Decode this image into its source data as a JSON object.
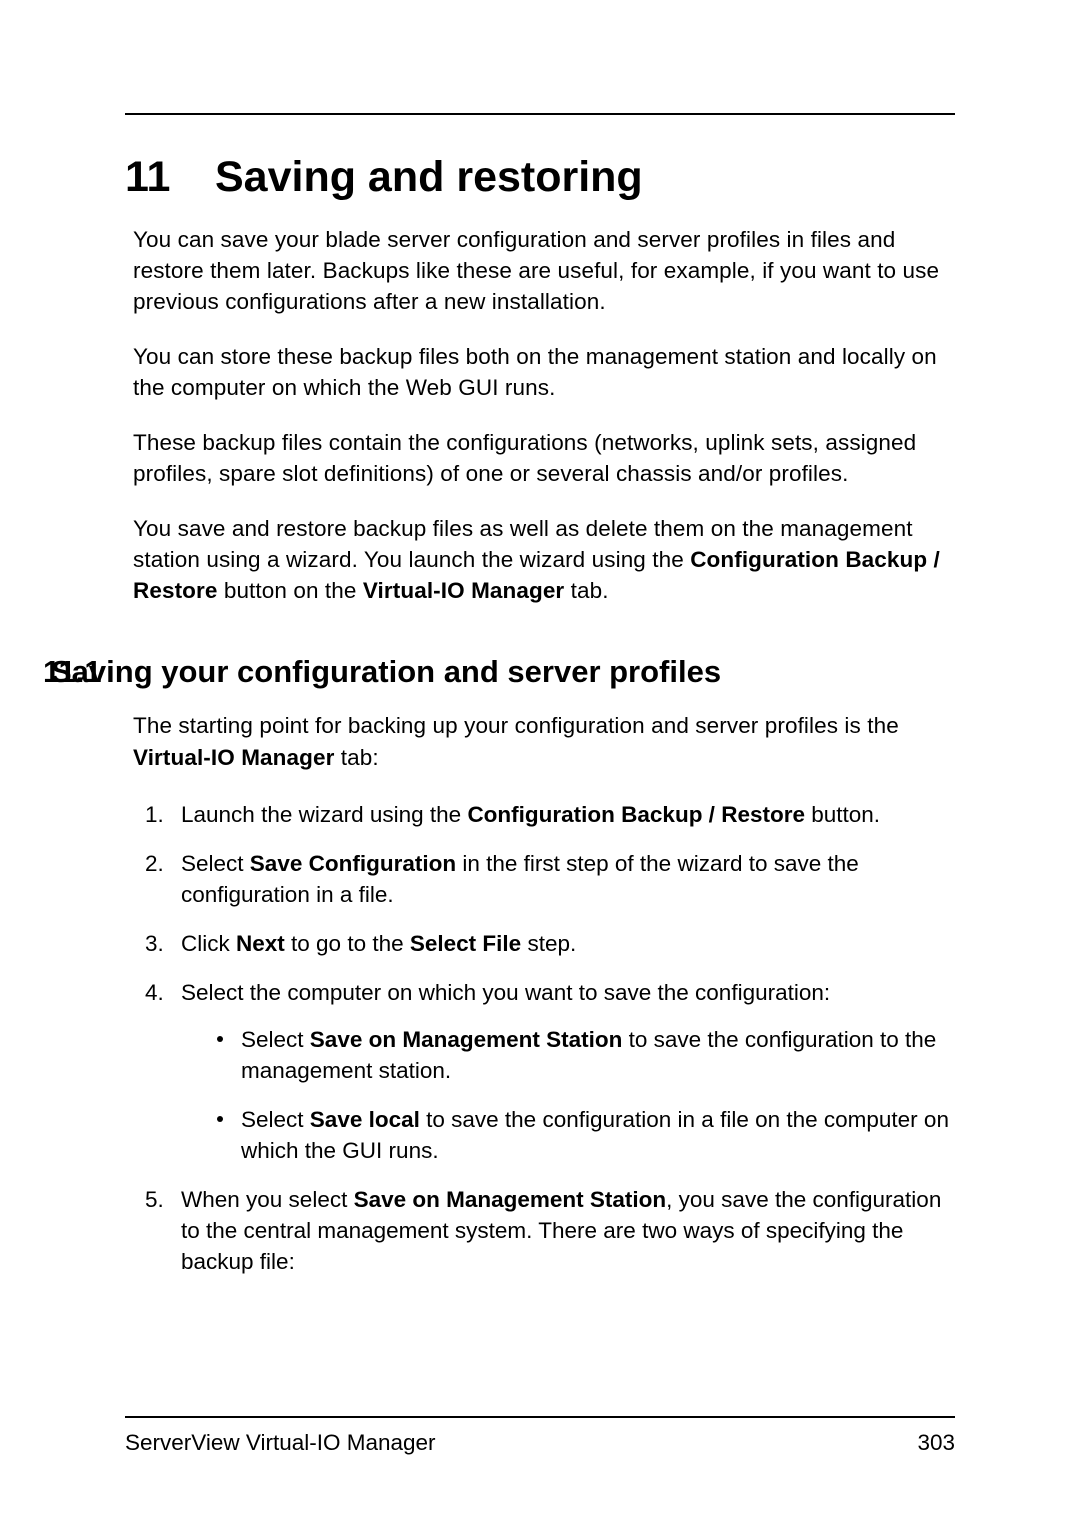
{
  "chapter": {
    "number": "11",
    "title": "Saving and restoring"
  },
  "paragraphs": {
    "p1": "You can save your blade server configuration and server profiles in files and restore them later. Backups like these are useful, for example, if you want to use previous configurations after a new installation.",
    "p2": "You can store these backup files both on the management station and locally on the computer on which the Web GUI runs.",
    "p3": "These backup files contain the configurations (networks, uplink sets, assigned profiles, spare slot definitions) of one or several chassis and/or profiles.",
    "p4_pre": "You save and restore backup files as well as delete them on the management station using a wizard. You launch the wizard using the ",
    "p4_bold1": "Configuration Backup / Restore",
    "p4_mid": " button on the ",
    "p4_bold2": "Virtual-IO Manager",
    "p4_post": " tab."
  },
  "section": {
    "number": "11.1",
    "title": "Saving your configuration and server profiles",
    "intro_pre": "The starting point for backing up your configuration and server profiles is the ",
    "intro_bold": "Virtual-IO Manager",
    "intro_post": " tab:"
  },
  "steps": {
    "s1_pre": "Launch the wizard using the ",
    "s1_bold": "Configuration Backup / Restore",
    "s1_post": " button.",
    "s2_pre": "Select ",
    "s2_bold": "Save Configuration",
    "s2_post": " in the first step of the wizard to save the configuration in a file.",
    "s3_pre": "Click ",
    "s3_bold1": "Next",
    "s3_mid": " to go to the ",
    "s3_bold2": "Select File",
    "s3_post": " step.",
    "s4_intro": "Select the computer on which you want to save the configuration:",
    "s4_b1_pre": "Select ",
    "s4_b1_bold": "Save on Management Station",
    "s4_b1_post": " to save the configuration to the management station.",
    "s4_b2_pre": "Select ",
    "s4_b2_bold": "Save local",
    "s4_b2_post": " to save the configuration in a file on the computer on which the GUI runs.",
    "s5_pre": "When you select ",
    "s5_bold": "Save on Management Station",
    "s5_post": ", you save the configuration to the central management system. There are two ways of specifying the backup file:"
  },
  "footer": {
    "left": "ServerView Virtual-IO Manager",
    "right": "303"
  }
}
